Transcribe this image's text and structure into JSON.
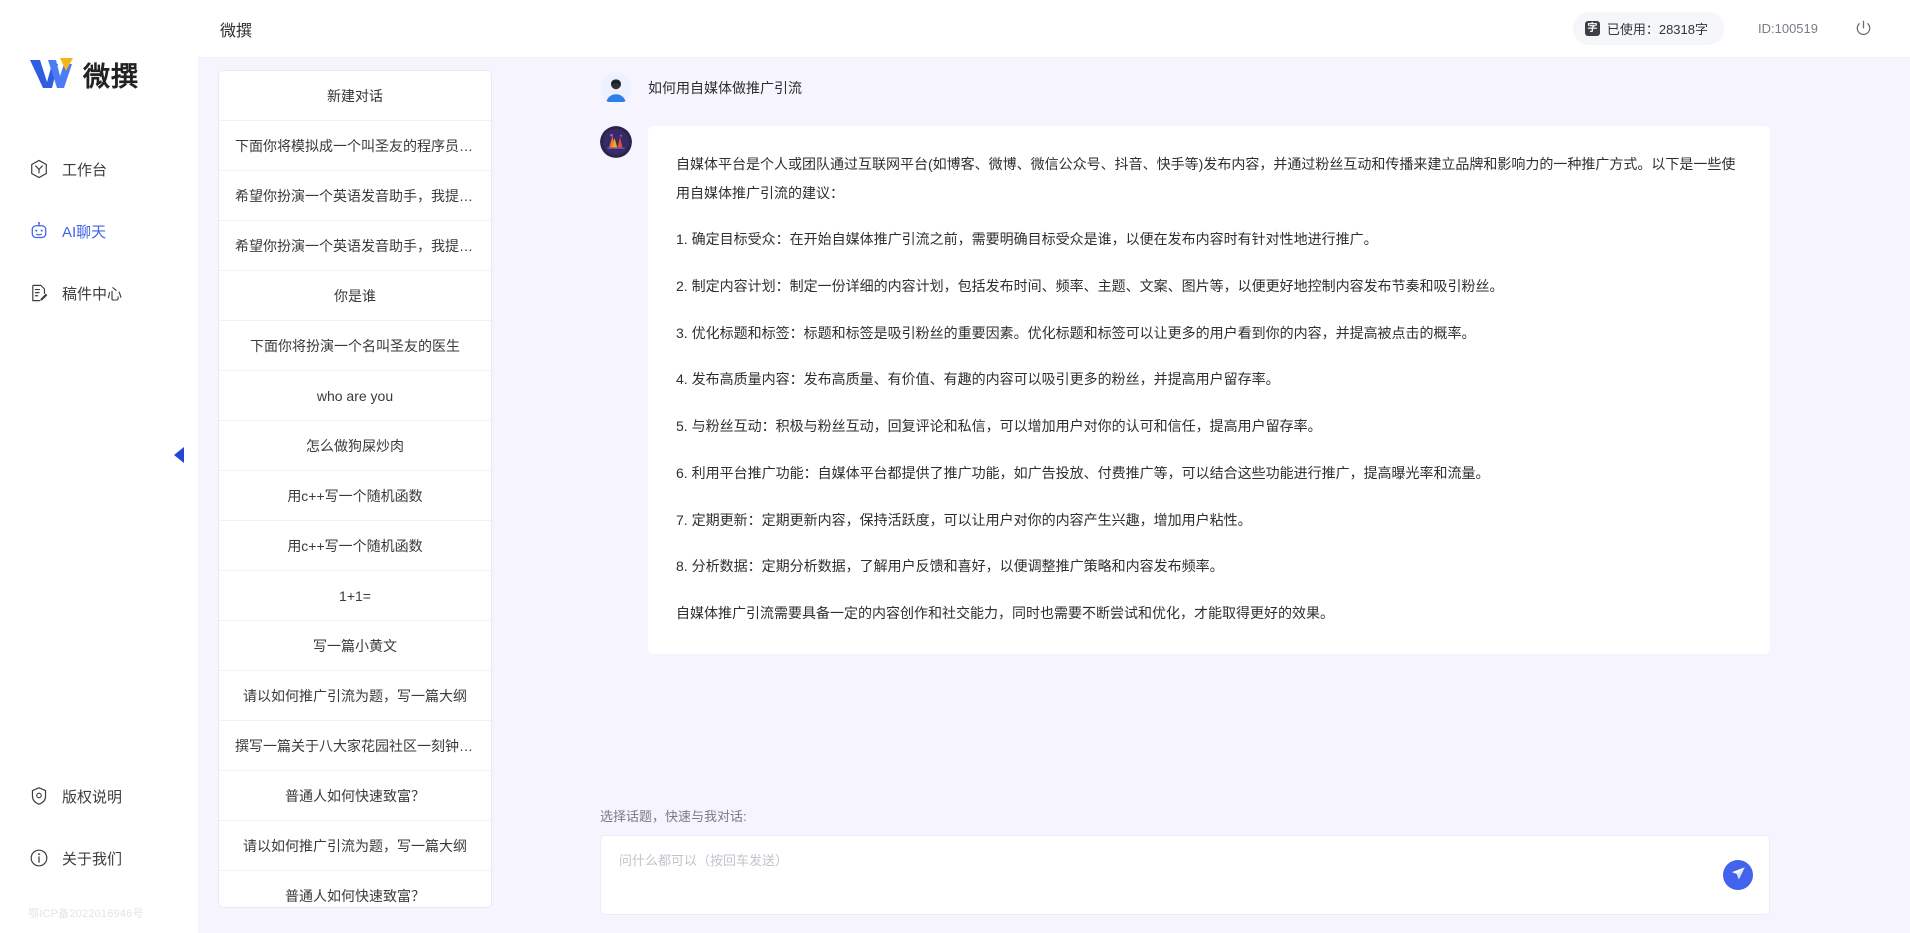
{
  "brand": {
    "name": "微撰",
    "logo_icon": "w-logo-icon"
  },
  "sidebar": {
    "items": [
      {
        "label": "工作台",
        "icon": "workbench-icon",
        "active": false
      },
      {
        "label": "AI聊天",
        "icon": "robot-icon",
        "active": true
      },
      {
        "label": "稿件中心",
        "icon": "document-edit-icon",
        "active": false
      }
    ],
    "bottom_items": [
      {
        "label": "版权说明",
        "icon": "shield-icon"
      },
      {
        "label": "关于我们",
        "icon": "info-icon"
      }
    ],
    "icp": "鄂ICP备2022016946号"
  },
  "topbar": {
    "title": "微撰",
    "usage_label": "已使用：28318字",
    "usage_badge": "字",
    "user_id": "ID:100519",
    "power_icon": "power-icon"
  },
  "conversations": {
    "new_chat_label": "新建对话",
    "items": [
      "下面你将模拟成一个叫圣友的程序员，我说...",
      "希望你扮演一个英语发音助手，我提供给你...",
      "希望你扮演一个英语发音助手，我提供给你...",
      "你是谁",
      "下面你将扮演一个名叫圣友的医生",
      "who are you",
      "怎么做狗屎炒肉",
      "用c++写一个随机函数",
      "用c++写一个随机函数",
      "1+1=",
      "写一篇小黄文",
      "请以如何推广引流为题，写一篇大纲",
      "撰写一篇关于八大家花园社区一刻钟便民生...",
      "普通人如何快速致富？",
      "请以如何推广引流为题，写一篇大纲",
      "普通人如何快速致富？"
    ],
    "collapse_icon": "chevron-left-icon"
  },
  "chat": {
    "user_message": "如何用自媒体做推广引流",
    "user_avatar_icon": "user-avatar-icon",
    "ai_avatar_icon": "ai-avatar-icon",
    "ai_paragraphs": [
      "自媒体平台是个人或团队通过互联网平台(如博客、微博、微信公众号、抖音、快手等)发布内容，并通过粉丝互动和传播来建立品牌和影响力的一种推广方式。以下是一些使用自媒体推广引流的建议：",
      "1. 确定目标受众：在开始自媒体推广引流之前，需要明确目标受众是谁，以便在发布内容时有针对性地进行推广。",
      "2. 制定内容计划：制定一份详细的内容计划，包括发布时间、频率、主题、文案、图片等，以便更好地控制内容发布节奏和吸引粉丝。",
      "3. 优化标题和标签：标题和标签是吸引粉丝的重要因素。优化标题和标签可以让更多的用户看到你的内容，并提高被点击的概率。",
      "4. 发布高质量内容：发布高质量、有价值、有趣的内容可以吸引更多的粉丝，并提高用户留存率。",
      "5. 与粉丝互动：积极与粉丝互动，回复评论和私信，可以增加用户对你的认可和信任，提高用户留存率。",
      "6. 利用平台推广功能：自媒体平台都提供了推广功能，如广告投放、付费推广等，可以结合这些功能进行推广，提高曝光率和流量。",
      "7. 定期更新：定期更新内容，保持活跃度，可以让用户对你的内容产生兴趣，增加用户粘性。",
      "8. 分析数据：定期分析数据，了解用户反馈和喜好，以便调整推广策略和内容发布频率。",
      "自媒体推广引流需要具备一定的内容创作和社交能力，同时也需要不断尝试和优化，才能取得更好的效果。"
    ]
  },
  "composer": {
    "label": "选择话题，快速与我对话:",
    "placeholder": "问什么都可以（按回车发送）",
    "value": "",
    "send_icon": "send-plane-icon"
  },
  "colors": {
    "accent": "#4263eb",
    "page_bg": "#f6f5ff",
    "panel_bg": "#ffffff"
  }
}
